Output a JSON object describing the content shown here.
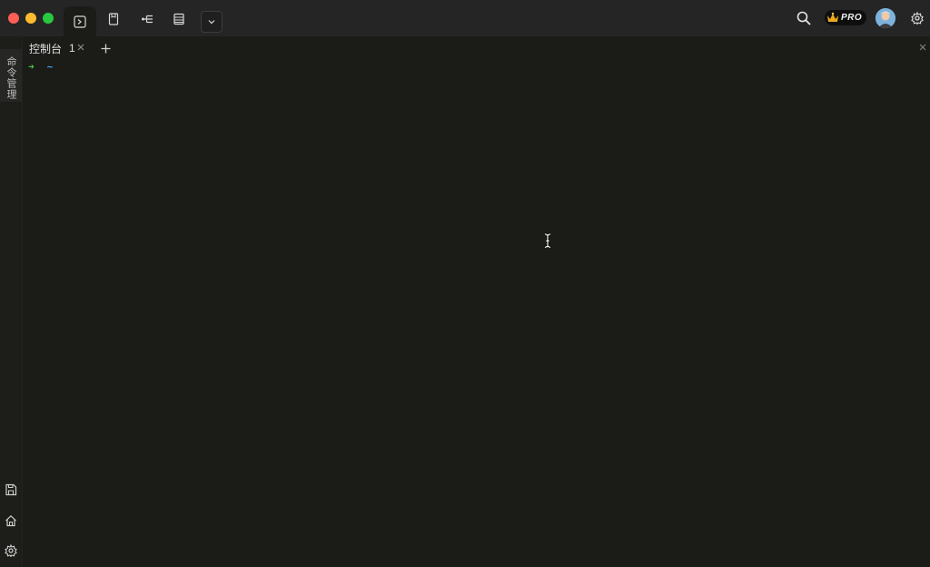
{
  "window": {
    "traffic_lights": [
      "close",
      "minimize",
      "maximize"
    ],
    "colors": {
      "close": "#fe5f57",
      "minimize": "#febc2e",
      "maximize": "#28c840",
      "background": "#1b1b18",
      "prompt_arrow": "#4ec94e",
      "prompt_dir": "#3fa7ff"
    }
  },
  "toolbar": {
    "icons": [
      "terminal-icon",
      "file-icon",
      "tree-icon",
      "list-icon",
      "chevron-down-icon"
    ],
    "pro_badge_label": "PRO",
    "right_icons": [
      "search-icon",
      "crown-icon",
      "avatar",
      "gear-icon"
    ]
  },
  "sidebar": {
    "command_label": "命令管理",
    "bottom_icons": [
      "save-icon",
      "home-icon",
      "gear-icon"
    ]
  },
  "tabs": [
    {
      "label": "控制台",
      "number": "1"
    }
  ],
  "terminal": {
    "prompt_arrow": "➜",
    "prompt_dir": "~"
  }
}
